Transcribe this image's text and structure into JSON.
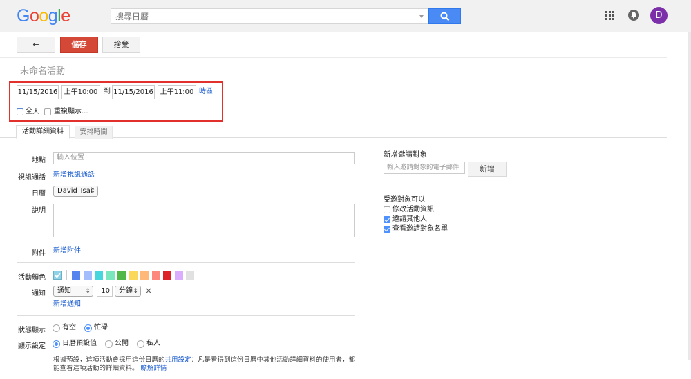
{
  "header": {
    "logo": "Google",
    "search_placeholder": "搜尋日曆",
    "avatar_letter": "D"
  },
  "toolbar": {
    "back_label": "←",
    "save_label": "儲存",
    "discard_label": "捨棄"
  },
  "event": {
    "title_placeholder": "未命名活動",
    "start_date": "11/15/2016",
    "start_time": "上午10:00",
    "to_label": "到",
    "end_date": "11/15/2016",
    "end_time": "上午11:00",
    "timezone_link": "時區",
    "all_day_label": "全天",
    "repeat_label": "重複顯示..."
  },
  "tabs": {
    "details": "活動詳細資料",
    "schedule": "安排時間"
  },
  "details": {
    "location_label": "地點",
    "location_placeholder": "輸入位置",
    "video_label": "視訊通話",
    "video_link": "新增視訊通話",
    "calendar_label": "日曆",
    "calendar_value": "David Tsai",
    "description_label": "說明",
    "attachment_label": "附件",
    "attachment_link": "新增附件",
    "color_label": "活動顏色",
    "colors": [
      "#5484ed",
      "#a4bdfc",
      "#46d6db",
      "#7ae7bf",
      "#51b749",
      "#fbd75b",
      "#ffb878",
      "#ff887c",
      "#dc2127",
      "#dbadff",
      "#e1e1e1"
    ],
    "reminder_label": "通知",
    "reminder_type": "通知",
    "reminder_value": "10",
    "reminder_unit": "分鐘",
    "reminder_remove": "×",
    "add_reminder_link": "新增通知",
    "status_label": "狀態顯示",
    "status_free": "有空",
    "status_busy": "忙碌",
    "visibility_label": "顯示設定",
    "visibility_default": "日曆預設值",
    "visibility_public": "公開",
    "visibility_private": "私人",
    "note_line1_a": "根據預設，這項活動會採用這份日曆的",
    "note_line1_link": "共用設定",
    "note_line1_b": "：凡是看得到這份日曆中其他活動詳細資料的使用者，都",
    "note_line2": "能查看這項活動的詳細資料。",
    "learn_more": "瞭解詳情"
  },
  "guests": {
    "title": "新增邀請對象",
    "input_placeholder": "輸入邀請對象的電子郵件",
    "add_button": "新增",
    "permissions_title": "受邀對象可以",
    "perm_modify": "修改活動資訊",
    "perm_invite": "邀請其他人",
    "perm_see_list": "查看邀請對象名單"
  }
}
